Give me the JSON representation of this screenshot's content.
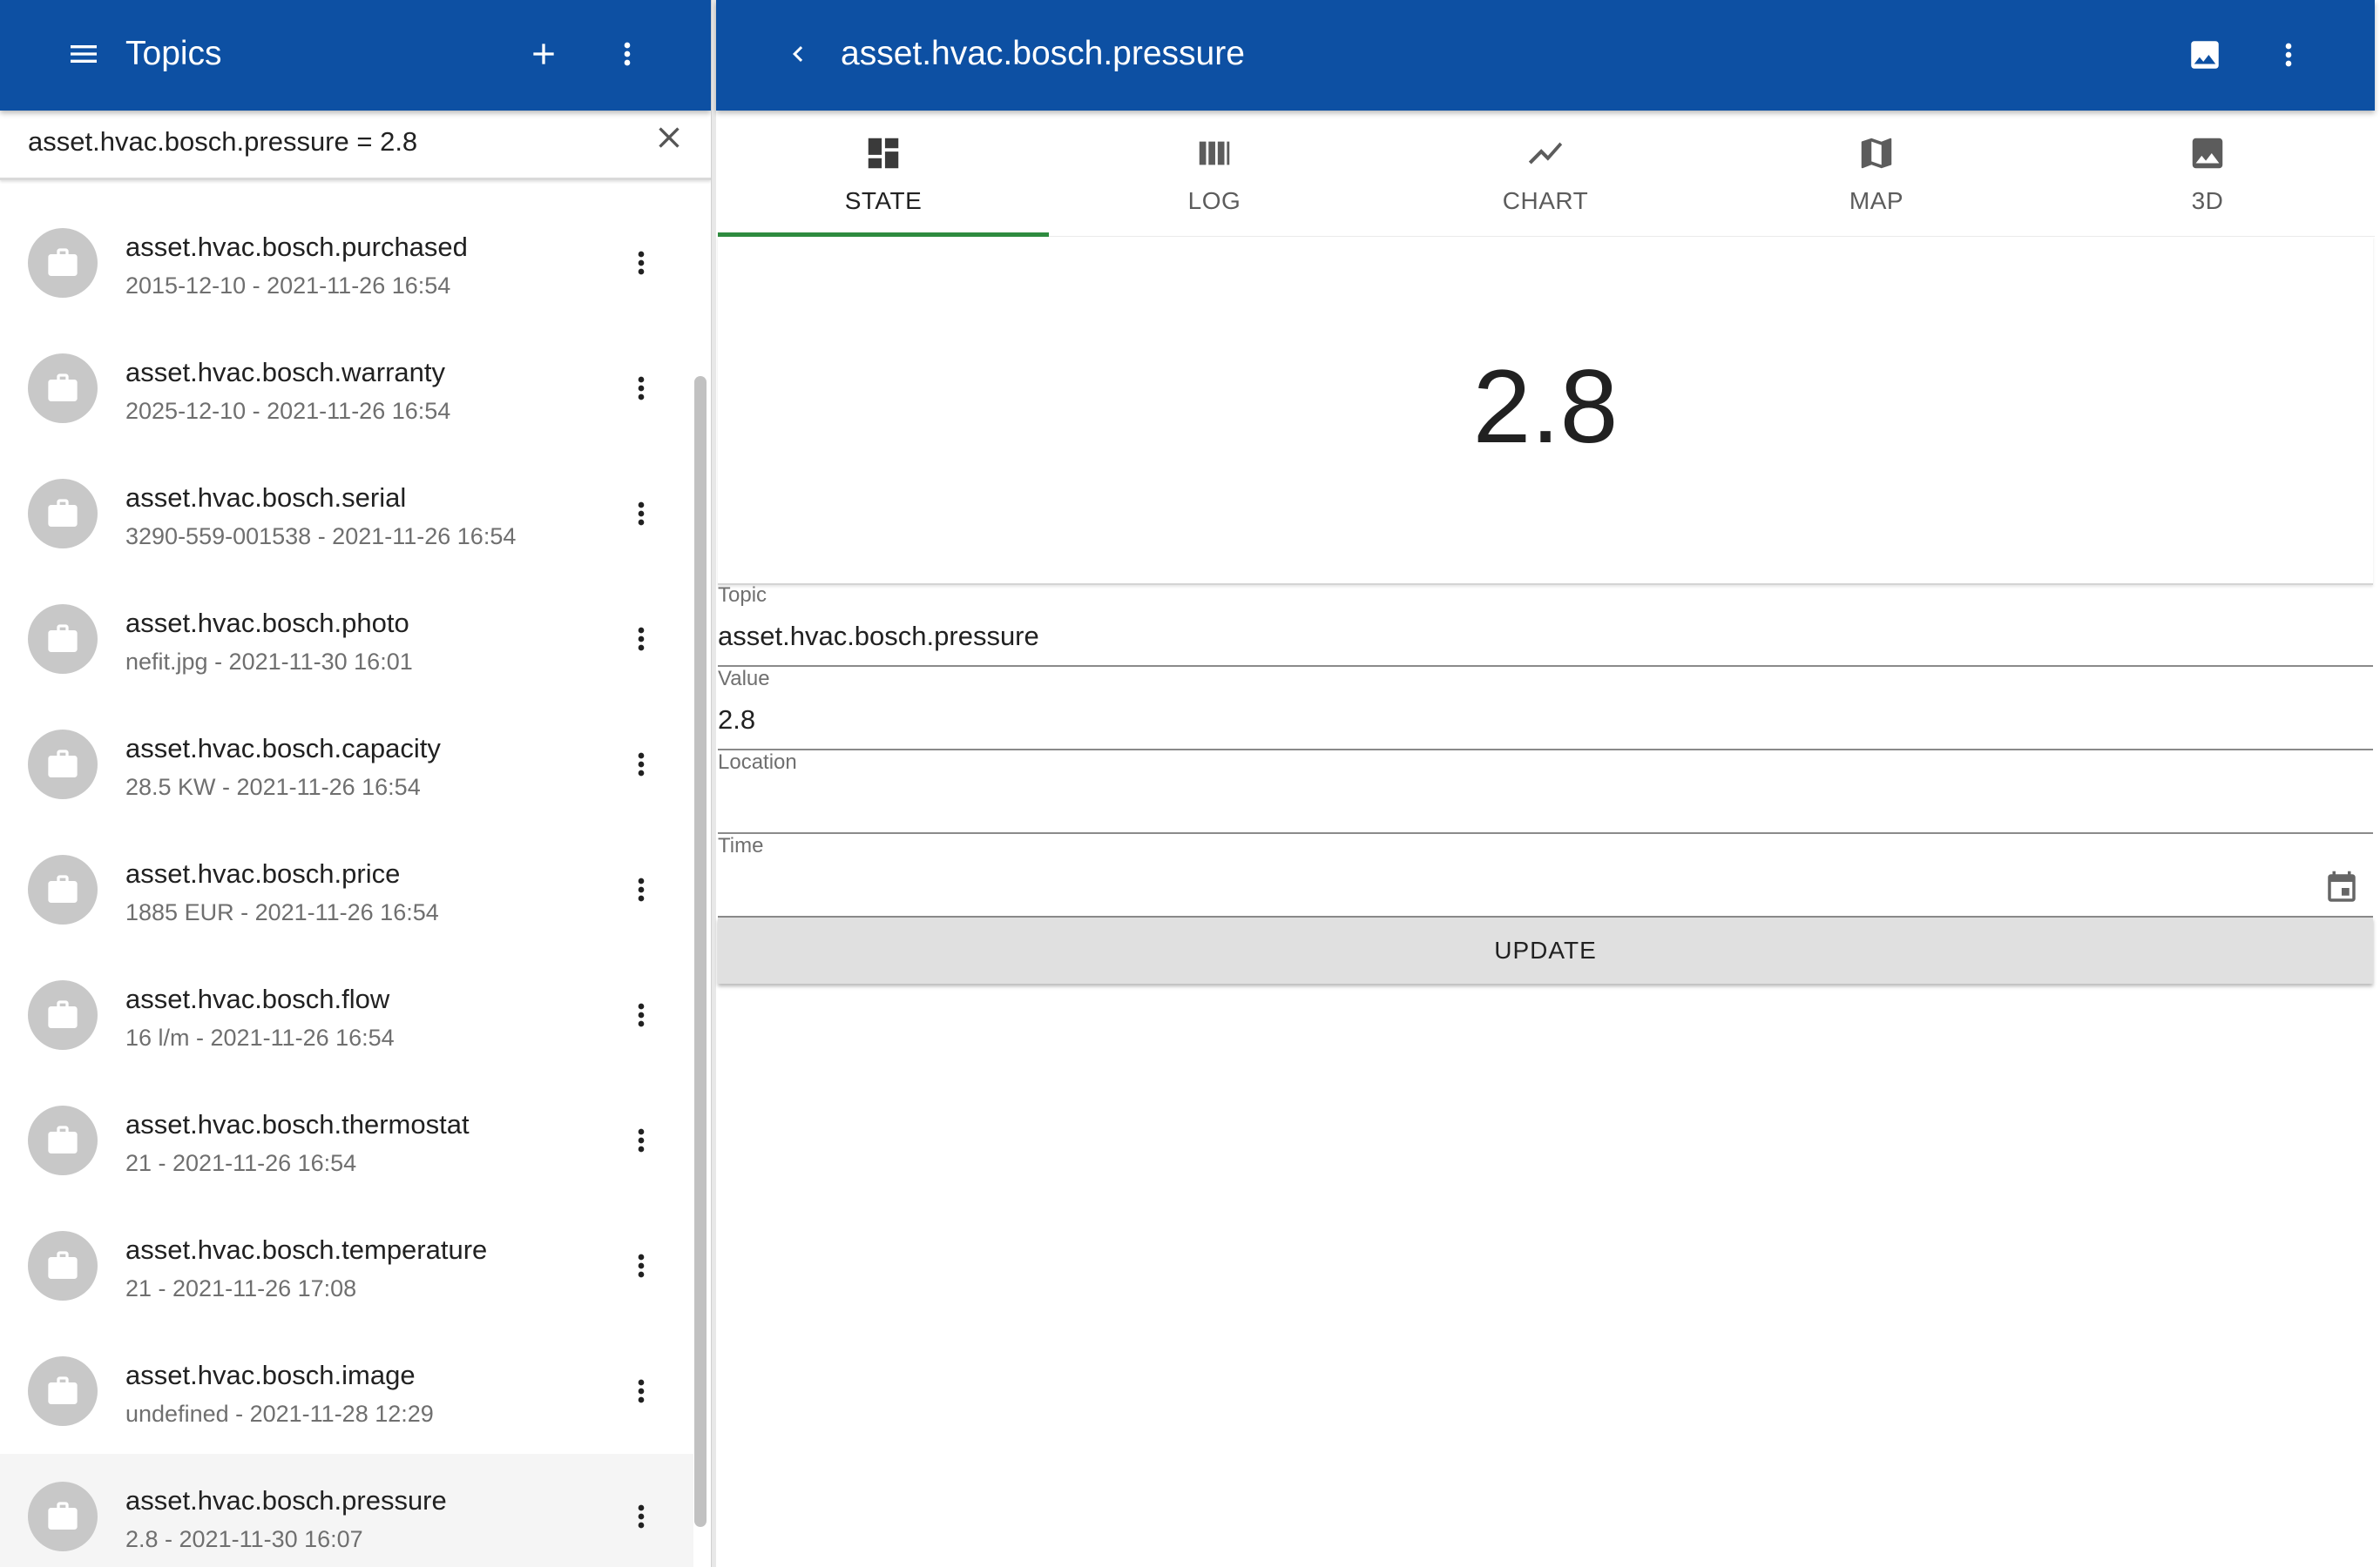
{
  "left": {
    "title": "Topics",
    "search": {
      "value": "asset.hvac.bosch.pressure = 2.8"
    },
    "icons": {
      "menu": "hamburger-menu-icon",
      "add": "plus-icon",
      "more": "more-vertical-icon",
      "clear": "close-icon",
      "item_avatar": "briefcase-icon"
    },
    "topics": [
      {
        "name": "asset.hvac.bosch.purchased",
        "sub": "2015-12-10 - 2021-11-26 16:54"
      },
      {
        "name": "asset.hvac.bosch.warranty",
        "sub": "2025-12-10 - 2021-11-26 16:54"
      },
      {
        "name": "asset.hvac.bosch.serial",
        "sub": "3290-559-001538 - 2021-11-26 16:54"
      },
      {
        "name": "asset.hvac.bosch.photo",
        "sub": "nefit.jpg - 2021-11-30 16:01"
      },
      {
        "name": "asset.hvac.bosch.capacity",
        "sub": "28.5 KW - 2021-11-26 16:54"
      },
      {
        "name": "asset.hvac.bosch.price",
        "sub": "1885 EUR - 2021-11-26 16:54"
      },
      {
        "name": "asset.hvac.bosch.flow",
        "sub": "16 l/m - 2021-11-26 16:54"
      },
      {
        "name": "asset.hvac.bosch.thermostat",
        "sub": "21 - 2021-11-26 16:54"
      },
      {
        "name": "asset.hvac.bosch.temperature",
        "sub": "21 - 2021-11-26 17:08"
      },
      {
        "name": "asset.hvac.bosch.image",
        "sub": "undefined - 2021-11-28 12:29"
      },
      {
        "name": "asset.hvac.bosch.pressure",
        "sub": "2.8 - 2021-11-30 16:07",
        "selected": true
      }
    ]
  },
  "right": {
    "title": "asset.hvac.bosch.pressure",
    "icons": {
      "back": "chevron-left-icon",
      "image": "image-icon",
      "more": "more-vertical-icon"
    },
    "tabs": [
      {
        "label": "STATE",
        "icon": "dashboard-icon",
        "active": true
      },
      {
        "label": "LOG",
        "icon": "view-columns-icon"
      },
      {
        "label": "CHART",
        "icon": "show-chart-icon"
      },
      {
        "label": "MAP",
        "icon": "map-icon"
      },
      {
        "label": "3D",
        "icon": "image-icon"
      }
    ],
    "state_value": "2.8",
    "form": {
      "topic": {
        "label": "Topic",
        "value": "asset.hvac.bosch.pressure"
      },
      "value": {
        "label": "Value",
        "value": "2.8"
      },
      "location": {
        "label": "Location",
        "value": ""
      },
      "time": {
        "label": "Time",
        "value": "",
        "icon": "calendar-icon"
      }
    },
    "update_label": "UPDATE"
  },
  "colors": {
    "appbar": "#0d50a3",
    "tab_indicator": "#2e8b3f",
    "avatar": "#c8c8c8"
  }
}
